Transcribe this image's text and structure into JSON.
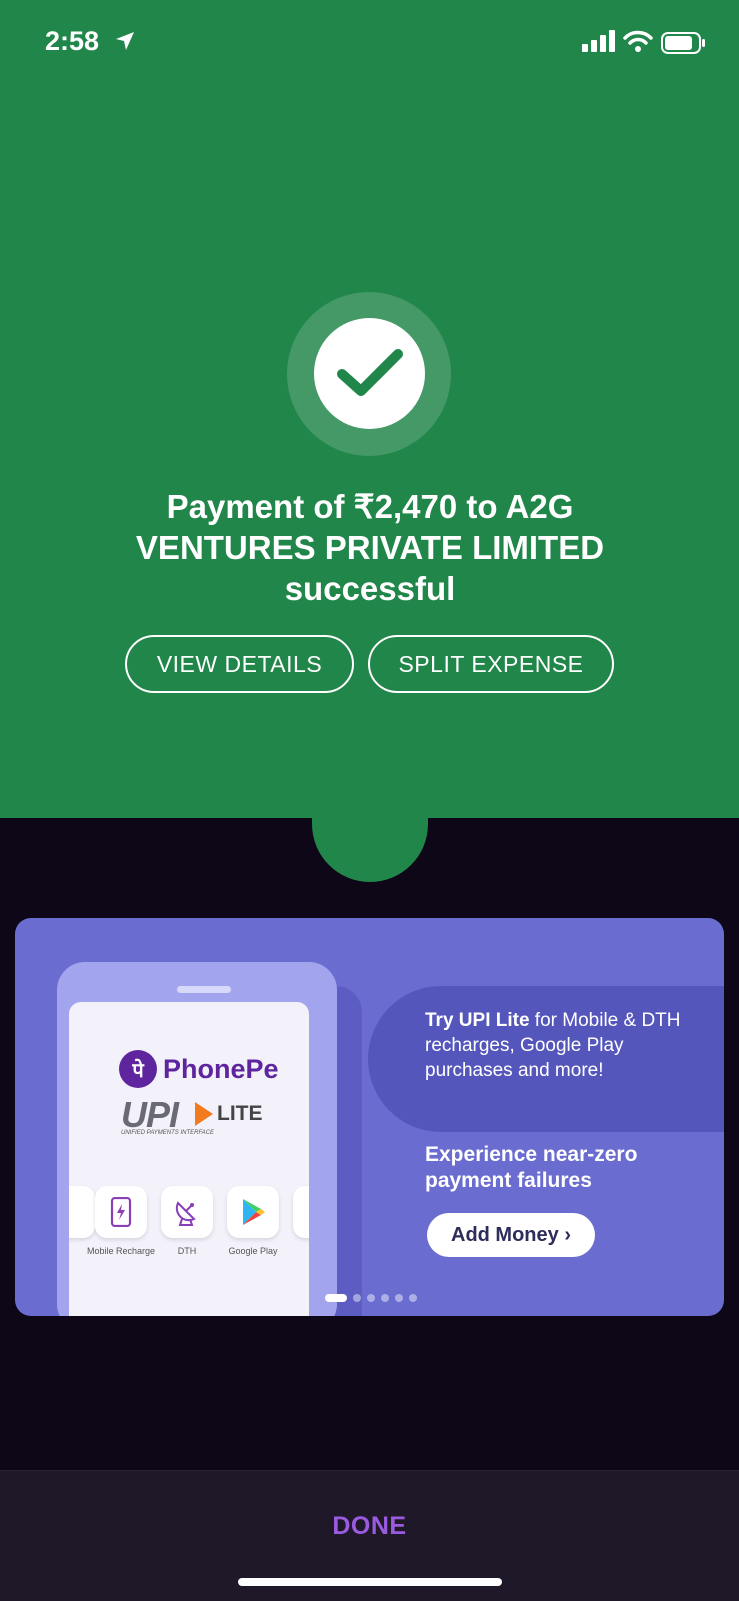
{
  "status_bar": {
    "time": "2:58"
  },
  "success": {
    "title": "Payment of ₹2,470 to A2G VENTURES PRIVATE LIMITED successful",
    "view_details_label": "VIEW DETAILS",
    "split_expense_label": "SPLIT EXPENSE"
  },
  "banner": {
    "brand": "PhonePe",
    "brand_logo_glyph": "पे",
    "upi_text": "UPI",
    "lite_text": "LITE",
    "upi_subtitle": "UNIFIED PAYMENTS INTERFACE",
    "tiles": [
      {
        "label": "Mobile Recharge",
        "icon": "mobile-recharge-icon"
      },
      {
        "label": "DTH",
        "icon": "dth-icon"
      },
      {
        "label": "Google Play",
        "icon": "google-play-icon"
      }
    ],
    "try_bold": "Try UPI Lite",
    "try_rest": " for Mobile & DTH recharges, Google Play purchases and more!",
    "experience": "Experience near-zero payment failures",
    "add_money_label": "Add Money ›",
    "carousel": {
      "count": 6,
      "active_index": 0
    }
  },
  "footer": {
    "done_label": "DONE"
  },
  "colors": {
    "success_green": "#21864a",
    "dark_bg": "#0d0718",
    "banner_purple": "#6b6cd0",
    "done_purple": "#9b5be0"
  }
}
